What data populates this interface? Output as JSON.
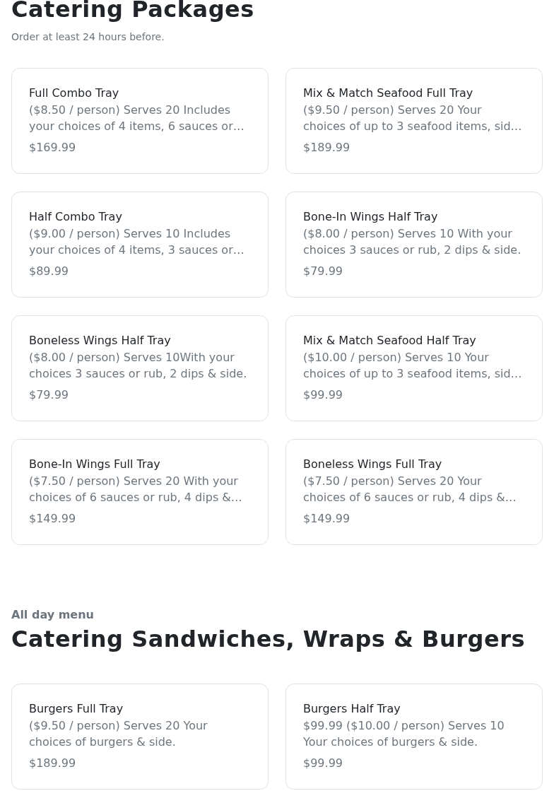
{
  "sections": [
    {
      "title": "Catering Packages",
      "subtitle": "Order at least 24 hours before.",
      "items": [
        {
          "name": "Full Combo Tray",
          "description": "($8.50 / person) Serves 20 Includes your choices of 4 items, 6 sauces or…",
          "price": "$169.99"
        },
        {
          "name": "Mix & Match Seafood Full Tray",
          "description": "($9.50 / person) Serves 20 Your choices of up to 3 seafood items, sid…",
          "price": "$189.99"
        },
        {
          "name": "Half Combo Tray",
          "description": "($9.00 / person) Serves 10 Includes your choices of 4 items, 3 sauces or…",
          "price": "$89.99"
        },
        {
          "name": "Bone-In Wings Half Tray",
          "description": "($8.00 / person) Serves 10 With your choices 3 sauces or rub, 2 dips & side.",
          "price": "$79.99"
        },
        {
          "name": "Boneless Wings Half Tray",
          "description": "($8.00 / person) Serves 10With your choices 3 sauces or rub, 2 dips & side.",
          "price": "$79.99"
        },
        {
          "name": "Mix & Match Seafood Half Tray",
          "description": "($10.00 / person) Serves 10 Your choices of up to 3 seafood items, sid…",
          "price": "$99.99"
        },
        {
          "name": "Bone-In Wings Full Tray",
          "description": "($7.50 / person) Serves 20 With your choices of 6 sauces or rub, 4 dips &…",
          "price": "$149.99"
        },
        {
          "name": "Boneless Wings Full Tray",
          "description": "($7.50 / person) Serves 20 Your choices of 6 sauces or rub, 4 dips &…",
          "price": "$149.99"
        }
      ]
    },
    {
      "eyebrow": "All day menu",
      "title": "Catering Sandwiches, Wraps & Burgers",
      "items": [
        {
          "name": "Burgers Full Tray",
          "description": "($9.50 / person) Serves 20 Your choices of burgers & side.",
          "price": "$189.99"
        },
        {
          "name": "Burgers Half Tray",
          "description": "$99.99 ($10.00 / person) Serves 10 Your choices of burgers & side.",
          "price": "$99.99"
        }
      ]
    }
  ]
}
